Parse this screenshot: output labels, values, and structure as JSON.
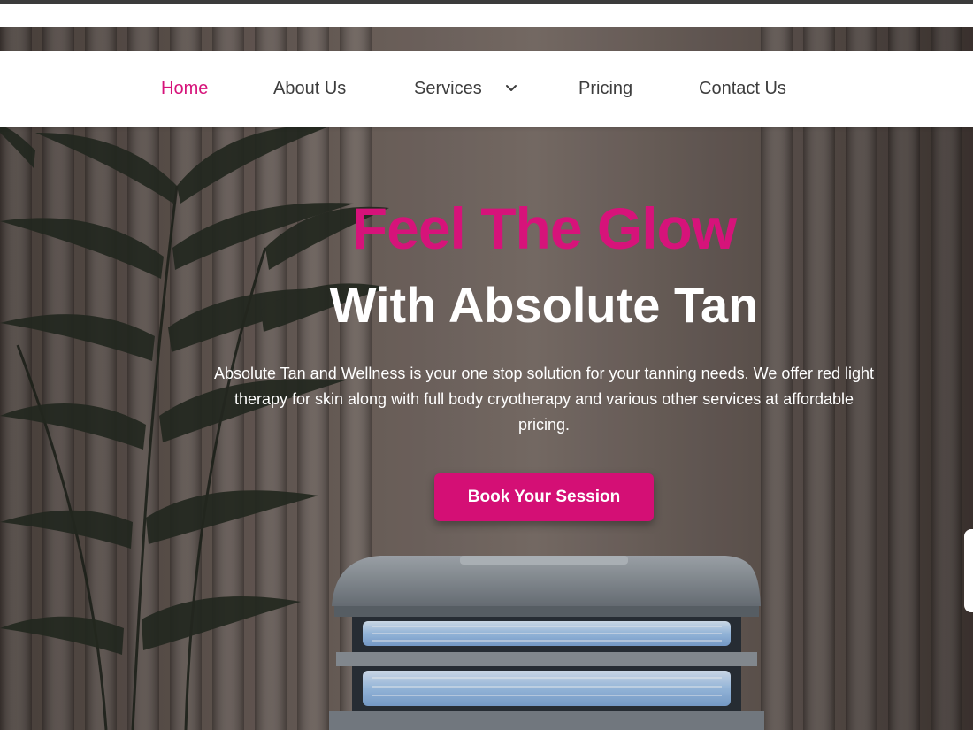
{
  "nav": {
    "items": [
      {
        "label": "Home",
        "active": true
      },
      {
        "label": "About Us"
      },
      {
        "label": "Services",
        "has_dropdown": true
      },
      {
        "label": "Pricing"
      },
      {
        "label": "Contact Us"
      }
    ]
  },
  "hero": {
    "headline": "Feel The Glow",
    "subheadline": "With Absolute Tan",
    "description": "Absolute Tan and Wellness is your one stop solution for your tanning needs. We offer red light therapy for skin along with full body cryotherapy and various other services at affordable pricing.",
    "cta_label": "Book Your Session"
  },
  "colors": {
    "accent": "#d6137a",
    "button": "#d40f75",
    "nav_text": "#3d3d3d",
    "hero_text": "#ffffff"
  },
  "icons": {
    "services_dropdown": "chevron-down-icon"
  }
}
